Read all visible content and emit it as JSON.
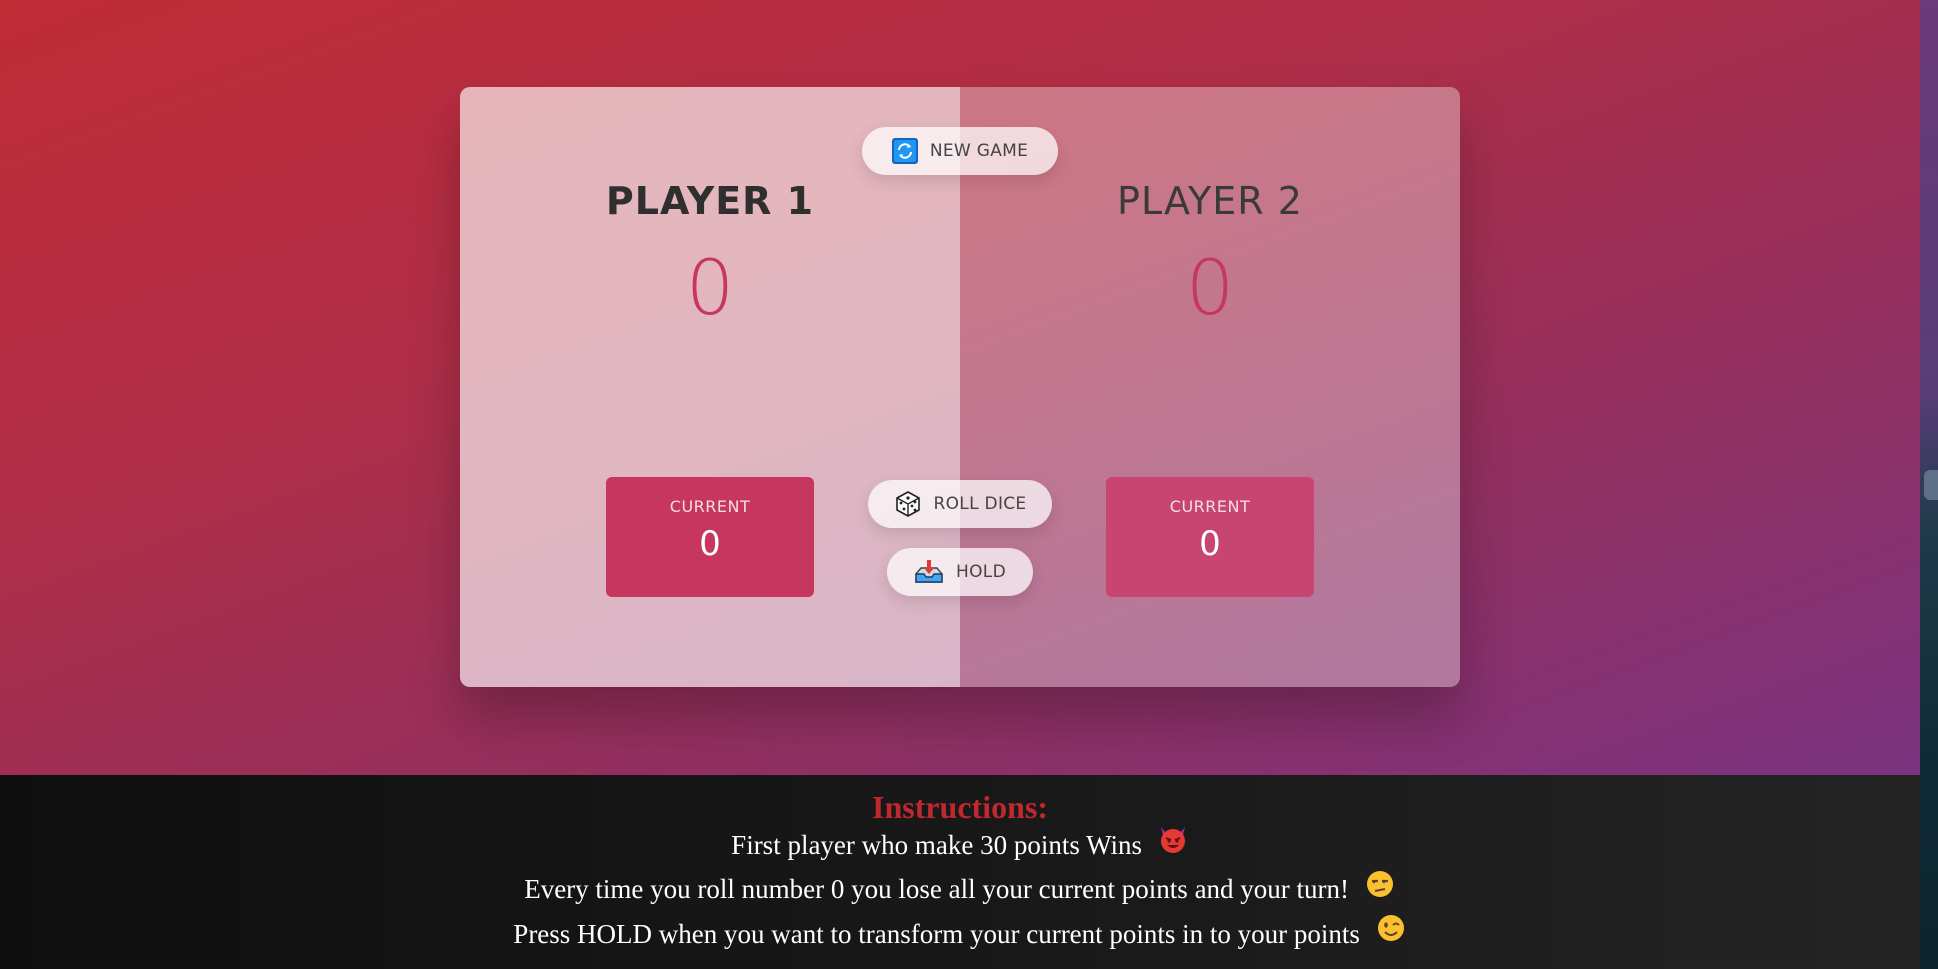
{
  "buttons": {
    "new_game": "NEW GAME",
    "roll_dice": "ROLL DICE",
    "hold": "HOLD"
  },
  "players": [
    {
      "name": "PLAYER 1",
      "score": "0",
      "current_label": "CURRENT",
      "current_score": "0"
    },
    {
      "name": "PLAYER 2",
      "score": "0",
      "current_label": "CURRENT",
      "current_score": "0"
    }
  ],
  "instructions": {
    "title": "Instructions:",
    "lines": [
      "First player who make 30 points Wins",
      "Every time you roll number 0 you lose all your current points and your turn!",
      "Press HOLD when you want to transform your current points in to your points"
    ]
  },
  "icons": {
    "new_game": "refresh-icon",
    "roll_dice": "dice-icon",
    "hold": "inbox-tray-icon",
    "line1": "smiling-devil-emoji",
    "line2": "unamused-face-emoji",
    "line3": "winking-face-emoji"
  },
  "colors": {
    "accent": "#c7365f",
    "instructions_title": "#c0282f"
  }
}
